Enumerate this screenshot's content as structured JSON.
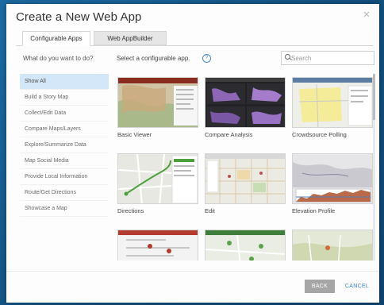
{
  "dialog": {
    "title": "Create a New Web App",
    "close_icon": "close-icon"
  },
  "tabs": [
    {
      "label": "Configurable Apps",
      "active": true
    },
    {
      "label": "Web AppBuilder",
      "active": false
    }
  ],
  "filter": {
    "prompt": "What do you want to do?",
    "items": [
      {
        "label": "Show All",
        "active": true
      },
      {
        "label": "Build a Story Map"
      },
      {
        "label": "Collect/Edit Data"
      },
      {
        "label": "Compare Maps/Layers"
      },
      {
        "label": "Explore/Summarize Data"
      },
      {
        "label": "Map Social Media"
      },
      {
        "label": "Provide Local Information"
      },
      {
        "label": "Route/Get Directions"
      },
      {
        "label": "Showcase a Map"
      }
    ]
  },
  "gallery": {
    "prompt": "Select a configurable app.",
    "help_icon": "help-icon",
    "apps": [
      {
        "label": "Basic Viewer"
      },
      {
        "label": "Compare Analysis"
      },
      {
        "label": "Crowdsource Polling"
      },
      {
        "label": "Directions"
      },
      {
        "label": "Edit"
      },
      {
        "label": "Elevation Profile"
      },
      {
        "label": ""
      },
      {
        "label": ""
      },
      {
        "label": ""
      }
    ]
  },
  "search": {
    "placeholder": "Search",
    "value": "",
    "icon": "search-icon"
  },
  "footer": {
    "back_label": "BACK",
    "cancel_label": "CANCEL"
  },
  "colors": {
    "accent": "#3f88c8",
    "selected_filter_bg": "#d4e7f8",
    "back_button_bg": "#a6a6a6"
  }
}
